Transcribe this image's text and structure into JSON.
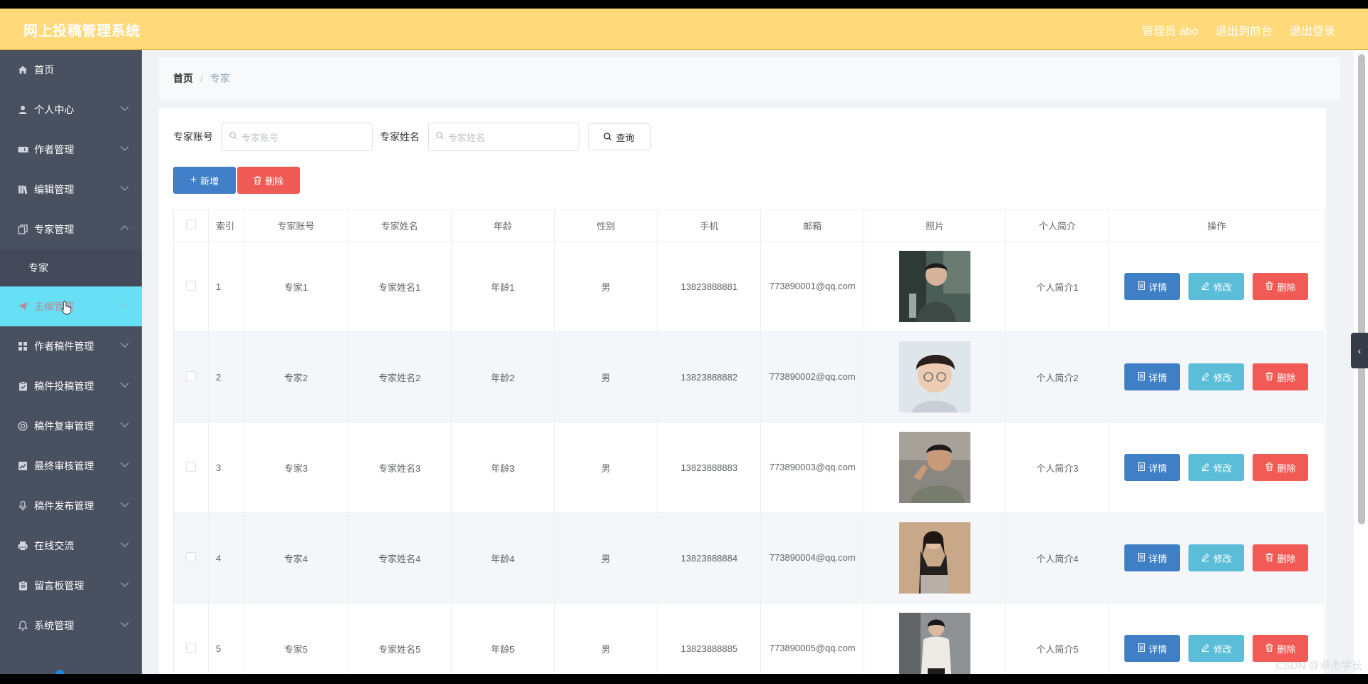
{
  "app": {
    "title": "网上投稿管理系统",
    "top_links": [
      "管理员 abo",
      "退出到前台",
      "退出登录"
    ]
  },
  "sidebar": {
    "items": [
      {
        "label": "首页",
        "icon": "home-icon",
        "chevron": "none"
      },
      {
        "label": "个人中心",
        "icon": "user-icon",
        "chevron": "down"
      },
      {
        "label": "作者管理",
        "icon": "ticket-icon",
        "chevron": "down"
      },
      {
        "label": "编辑管理",
        "icon": "books-icon",
        "chevron": "down"
      },
      {
        "label": "专家管理",
        "icon": "copy-icon",
        "chevron": "up"
      },
      {
        "label": "专家",
        "icon": "",
        "chevron": "none",
        "sub": true
      },
      {
        "label": "主编管理",
        "icon": "send-icon",
        "chevron": "down",
        "active": true
      },
      {
        "label": "作者稿件管理",
        "icon": "grid-icon",
        "chevron": "down"
      },
      {
        "label": "稿件投稿管理",
        "icon": "clipboard-icon",
        "chevron": "down"
      },
      {
        "label": "稿件复审管理",
        "icon": "support-icon",
        "chevron": "down"
      },
      {
        "label": "最终审核管理",
        "icon": "chart-icon",
        "chevron": "down"
      },
      {
        "label": "稿件发布管理",
        "icon": "mic-icon",
        "chevron": "down"
      },
      {
        "label": "在线交流",
        "icon": "printer-icon",
        "chevron": "down"
      },
      {
        "label": "留言板管理",
        "icon": "clipboard-check-icon",
        "chevron": "down"
      },
      {
        "label": "系统管理",
        "icon": "bell-icon",
        "chevron": "down"
      }
    ]
  },
  "breadcrumb": {
    "home": "首页",
    "separator": "/",
    "current": "专家"
  },
  "search": {
    "account_label": "专家账号",
    "account_placeholder": "专家账号",
    "name_label": "专家姓名",
    "name_placeholder": "专家姓名",
    "query_button": "查询"
  },
  "actions": {
    "add": "新增",
    "delete": "删除"
  },
  "table": {
    "headers": [
      "索引",
      "专家账号",
      "专家姓名",
      "年龄",
      "性别",
      "手机",
      "邮箱",
      "照片",
      "个人简介",
      "操作"
    ],
    "rows": [
      {
        "index": "1",
        "account": "专家1",
        "name": "专家姓名1",
        "age": "年龄1",
        "gender": "男",
        "phone": "13823888881",
        "email": "773890001@qq.com",
        "intro": "个人简介1"
      },
      {
        "index": "2",
        "account": "专家2",
        "name": "专家姓名2",
        "age": "年龄2",
        "gender": "男",
        "phone": "13823888882",
        "email": "773890002@qq.com",
        "intro": "个人简介2"
      },
      {
        "index": "3",
        "account": "专家3",
        "name": "专家姓名3",
        "age": "年龄3",
        "gender": "男",
        "phone": "13823888883",
        "email": "773890003@qq.com",
        "intro": "个人简介3"
      },
      {
        "index": "4",
        "account": "专家4",
        "name": "专家姓名4",
        "age": "年龄4",
        "gender": "男",
        "phone": "13823888884",
        "email": "773890004@qq.com",
        "intro": "个人简介4"
      },
      {
        "index": "5",
        "account": "专家5",
        "name": "专家姓名5",
        "age": "年龄5",
        "gender": "男",
        "phone": "13823888885",
        "email": "773890005@qq.com",
        "intro": "个人简介5"
      }
    ],
    "row_buttons": {
      "detail": "详情",
      "edit": "修改",
      "delete": "删除"
    }
  },
  "watermark": "CSDN @卓杰学长",
  "colors": {
    "topbar": "#ffd97a",
    "sidebar": "#49505f",
    "active": "#67e0f5",
    "primary": "#4180c9",
    "danger": "#f05a55",
    "info": "#5bbdd8"
  }
}
